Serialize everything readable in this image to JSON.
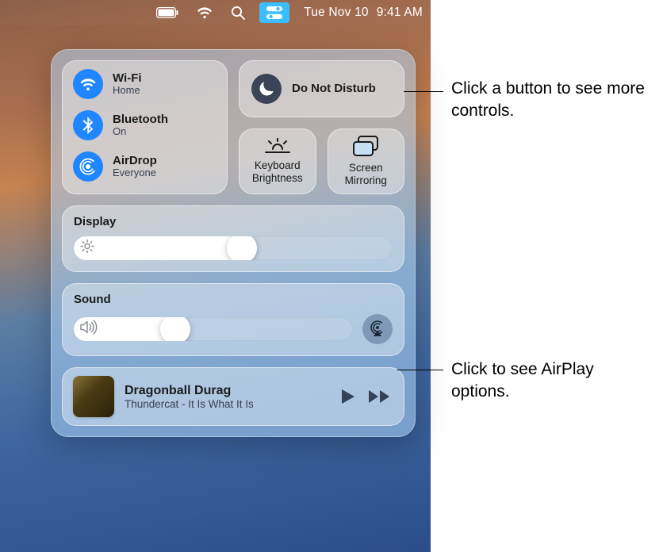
{
  "menubar": {
    "date": "Tue Nov 10",
    "time": "9:41 AM"
  },
  "connectivity": {
    "wifi": {
      "title": "Wi-Fi",
      "status": "Home"
    },
    "bluetooth": {
      "title": "Bluetooth",
      "status": "On"
    },
    "airdrop": {
      "title": "AirDrop",
      "status": "Everyone"
    }
  },
  "dnd": {
    "title": "Do Not Disturb"
  },
  "kb_brightness": {
    "label": "Keyboard Brightness"
  },
  "screen_mirroring": {
    "label": "Screen Mirroring"
  },
  "display": {
    "label": "Display",
    "value_percent": 49
  },
  "sound": {
    "label": "Sound",
    "value_percent": 32
  },
  "media": {
    "title": "Dragonball Durag",
    "subtitle": "Thundercat - It Is What It Is"
  },
  "callouts": {
    "top": "Click a button to see more controls.",
    "bottom": "Click to see AirPlay options."
  },
  "colors": {
    "accent_blue": "#1f86ff",
    "panel_tint": "#aed4f5"
  }
}
